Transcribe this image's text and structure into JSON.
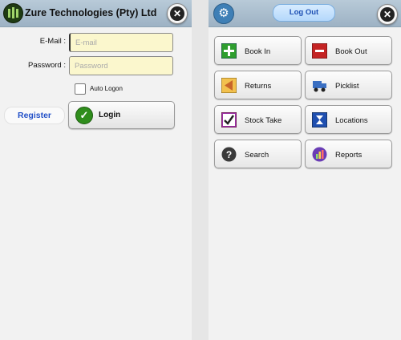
{
  "login_screen": {
    "app_title": "Zure Technologies (Pty) Ltd",
    "email": {
      "label": "E-Mail :",
      "placeholder": "E-mail",
      "value": ""
    },
    "password": {
      "label": "Password :",
      "placeholder": "Password",
      "value": ""
    },
    "auto_logon": {
      "label": "Auto Logon",
      "checked": false
    },
    "register_label": "Register",
    "login_label": "Login"
  },
  "menu_screen": {
    "logout_label": "Log Out",
    "tiles": [
      {
        "label": "Book In",
        "icon": "plus-icon",
        "color": "#2e9e2e"
      },
      {
        "label": "Book Out",
        "icon": "minus-icon",
        "color": "#c42323"
      },
      {
        "label": "Returns",
        "icon": "returns-icon",
        "color": "#c8662a"
      },
      {
        "label": "Picklist",
        "icon": "truck-icon",
        "color": "#3a6fc2"
      },
      {
        "label": "Stock Take",
        "icon": "check-icon",
        "color": "#9b2fa5"
      },
      {
        "label": "Locations",
        "icon": "locations-icon",
        "color": "#1f4fb0"
      },
      {
        "label": "Search",
        "icon": "question-icon",
        "color": "#3a3a3a"
      },
      {
        "label": "Reports",
        "icon": "chart-icon",
        "color": "#6a3db5"
      }
    ]
  },
  "colors": {
    "header": "#a9bdce",
    "field_bg": "#fbf7cd",
    "link_blue": "#2250c8"
  }
}
